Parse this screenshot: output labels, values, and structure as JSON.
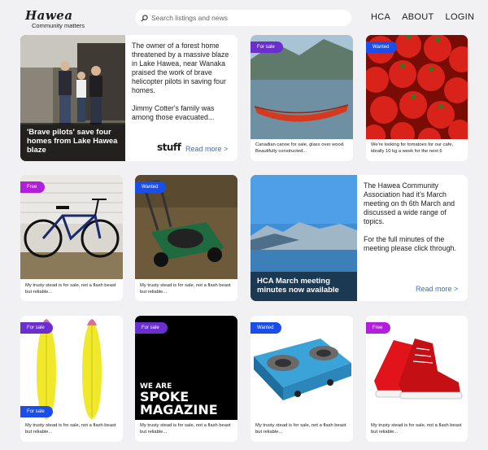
{
  "header": {
    "logo_title": "Hawea",
    "logo_subtitle": "Community matters",
    "search_placeholder": "Search listings and news",
    "nav": [
      "HCA",
      "ABOUT",
      "LOGIN"
    ]
  },
  "news": [
    {
      "title": "'Brave pilots' save four homes from Lake Hawea blaze",
      "paragraphs": [
        "The owner of a forest home threatened by a massive blaze in Lake Hawea, near Wanaka praised the work of brave helicopter pilots in saving four homes.",
        "Jimmy Cotter's family was among those evacuated..."
      ],
      "source": "stuff",
      "read_more": "Read more >"
    },
    {
      "title": "HCA March meeting minutes now available",
      "paragraphs": [
        "The Hawea Community Association had it's March meeting on th 6th March and discussed a wide range of topics.",
        "For the full minutes of the meeting please click through."
      ],
      "read_more": "Read more >"
    }
  ],
  "listings": [
    {
      "badge": "For sale",
      "caption": "Canadian canoe for sale, glass over wood. Beautifully constructed..."
    },
    {
      "badge": "Wanted",
      "caption": "We're looking for tomatoes for our cafe, ideally 10 kg a week for the next 6"
    },
    {
      "badge": "Free",
      "caption": "My trusty stead is for sale, not a flash beast but reliable..."
    },
    {
      "badge": "Wanted",
      "caption": "My trusty stead is for sale, not a flash beast but reliable..."
    },
    {
      "badge": "For sale",
      "badge2": "For sale",
      "caption": "My trusty stead is for sale, not a flash beast but reliable..."
    },
    {
      "badge": "For sale",
      "caption": "My trusty stead is for sale, not a flash beast but reliable...",
      "image_text": [
        "WE ARE",
        "SPOKE",
        "MAGAZINE"
      ]
    },
    {
      "badge": "Wanted",
      "caption": "My trusty stead is for sale, not a flash beast but reliable..."
    },
    {
      "badge": "Free",
      "caption": "My trusty stead is for sale, not a flash beast but reliable..."
    }
  ],
  "colors": {
    "for_sale": "#6b2fd0",
    "wanted": "#1b4ee8",
    "free": "#b11fdc",
    "link": "#3a72c9"
  }
}
